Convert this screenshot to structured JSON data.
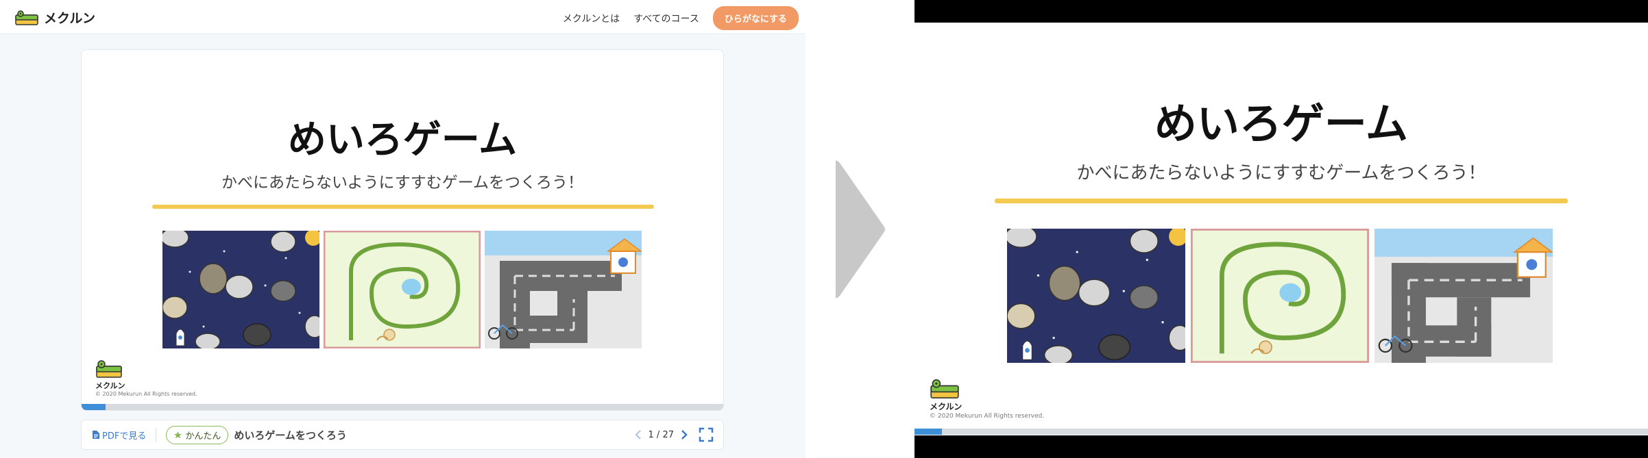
{
  "header": {
    "logo_text": "メクルン",
    "nav": [
      "メクルンとは",
      "すべてのコース"
    ],
    "hiragana_button": "ひらがなにする"
  },
  "slide": {
    "title": "めいろゲーム",
    "subtitle": "かべにあたらないようにすすむゲームをつくろう！",
    "logo_text": "メクルン",
    "copyright": "© 2020 Mekurun All Rights reserved.",
    "progress": 0.037,
    "thumbnails": [
      "space-maze",
      "snail-spiral-maze",
      "bicycle-road-maze"
    ]
  },
  "controls": {
    "pdf_label": "PDFで見る",
    "level": "かんたん",
    "course_title": "めいろゲームをつくろう",
    "page_indicator": "1 / 27"
  },
  "colors": {
    "accent_orange": "#f29a66",
    "progress_blue": "#3d8fd8",
    "underline_yellow": "#f4c94f",
    "level_green": "#8ab95a"
  }
}
